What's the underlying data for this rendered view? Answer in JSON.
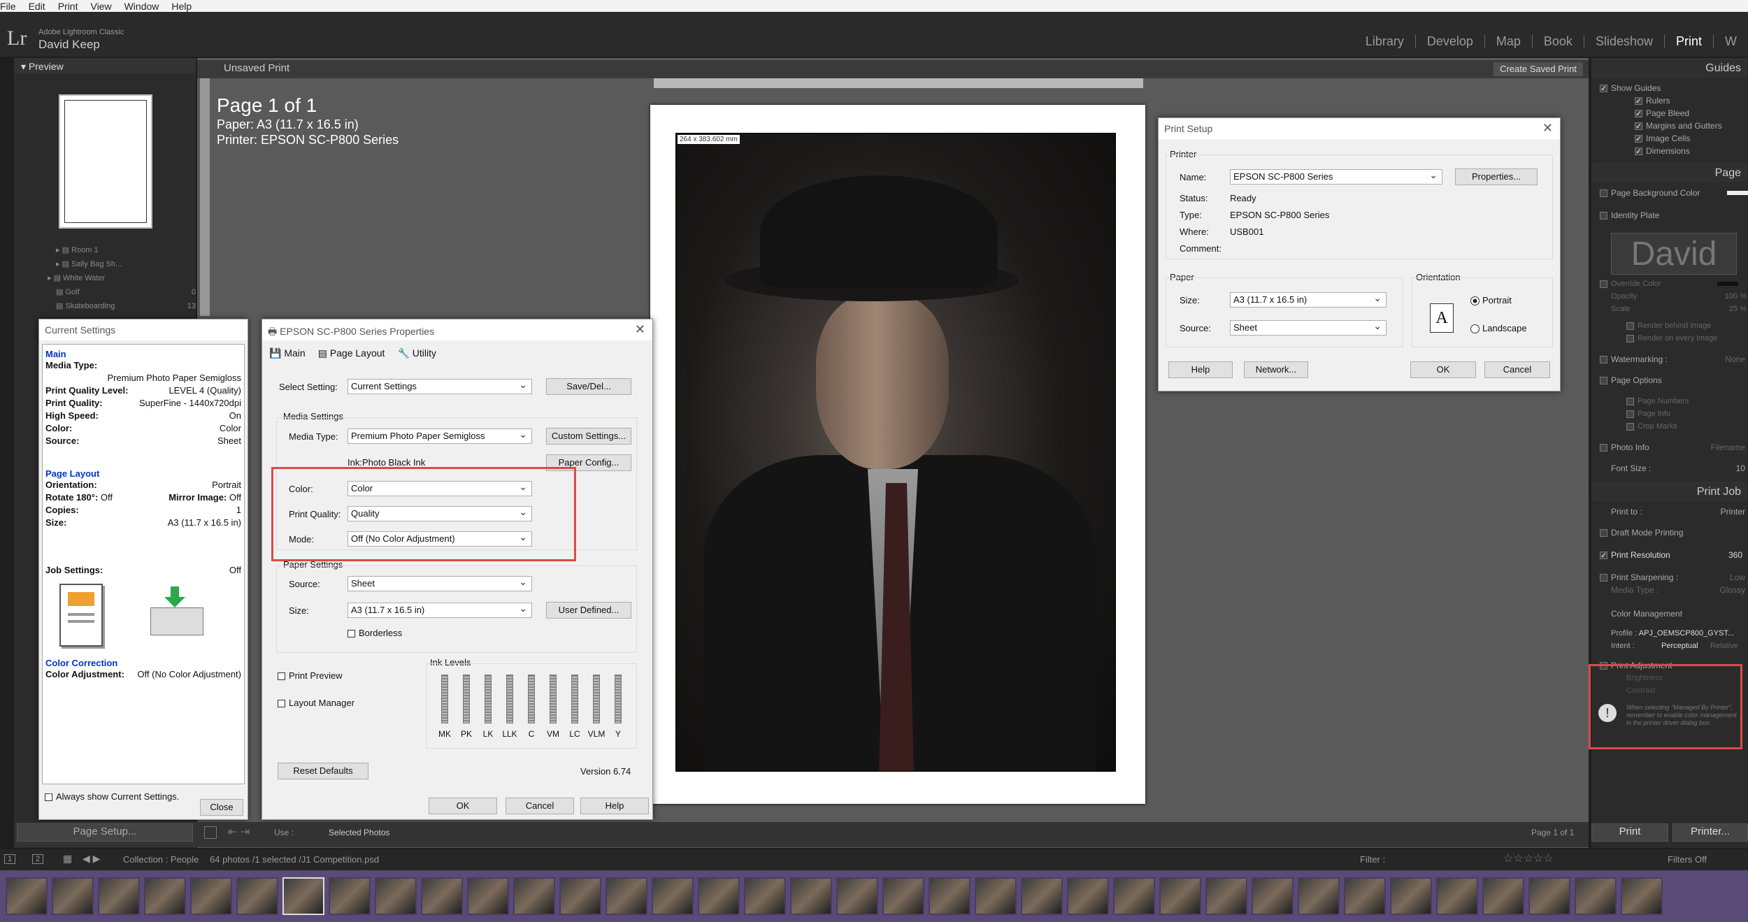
{
  "menu": [
    "File",
    "Edit",
    "Print",
    "View",
    "Window",
    "Help"
  ],
  "app": {
    "logo": "Lr",
    "name": "Adobe Lightroom Classic",
    "user": "David Keep"
  },
  "modules": [
    "Library",
    "Develop",
    "Map",
    "Book",
    "Slideshow",
    "Print",
    "W"
  ],
  "active_module": "Print",
  "left_panel": {
    "preview_label": "Preview",
    "collections": [
      {
        "name": "Room 1",
        "count": ""
      },
      {
        "name": "Sally Bag Sh...",
        "count": ""
      },
      {
        "name": "White Water",
        "count": ""
      },
      {
        "name": "Golf",
        "count": "0"
      },
      {
        "name": "Skateboarding",
        "count": "13"
      }
    ],
    "page_setup_btn": "Page Setup..."
  },
  "print_title": "Unsaved Print",
  "create_saved_print": "Create Saved Print",
  "page_info": {
    "page": "Page 1 of 1",
    "paper": "Paper:  A3 (11.7 x 16.5 in)",
    "printer": "Printer:  EPSON SC-P800 Series"
  },
  "photo_dims": "264 x 383.602 mm",
  "current_settings": {
    "title": "Current Settings",
    "main_label": "Main",
    "rows1": [
      {
        "k": "Media Type:",
        "v": ""
      },
      {
        "k": "",
        "v": "Premium Photo Paper Semigloss"
      },
      {
        "k": "Print Quality Level:",
        "v": "LEVEL 4 (Quality)"
      },
      {
        "k": "Print Quality:",
        "v": "SuperFine - 1440x720dpi"
      },
      {
        "k": "High Speed:",
        "v": "On"
      },
      {
        "k": "Color:",
        "v": "Color"
      },
      {
        "k": "Source:",
        "v": "Sheet"
      }
    ],
    "layout_label": "Page Layout",
    "rows2": [
      {
        "k": "Orientation:",
        "v": "Portrait"
      },
      {
        "k": "Rotate 180°:",
        "v": "Off"
      },
      {
        "k": "Mirror Image:",
        "v": "Off"
      },
      {
        "k": "Copies:",
        "v": "1"
      },
      {
        "k": "Size:",
        "v": "A3 (11.7 x 16.5 in)"
      }
    ],
    "job_settings": "Job Settings:",
    "job_value": "Off",
    "cc_label": "Color Correction",
    "cc_key": "Color Adjustment:",
    "cc_val": "Off (No Color Adjustment)",
    "always_show": "Always show Current Settings.",
    "close": "Close"
  },
  "epson": {
    "title": "EPSON SC-P800 Series Properties",
    "tabs": [
      "Main",
      "Page Layout",
      "Utility"
    ],
    "select_setting_label": "Select Setting:",
    "select_setting": "Current Settings",
    "save_del": "Save/Del...",
    "media_settings": "Media Settings",
    "media_type_label": "Media Type:",
    "media_type": "Premium Photo Paper Semigloss",
    "custom_settings": "Custom Settings...",
    "ink_label": "Ink:Photo Black Ink",
    "paper_config": "Paper Config...",
    "color_label": "Color:",
    "color": "Color",
    "pq_label": "Print Quality:",
    "pq": "Quality",
    "mode_label": "Mode:",
    "mode": "Off (No Color Adjustment)",
    "paper_settings": "Paper Settings",
    "source_label": "Source:",
    "source": "Sheet",
    "size_label": "Size:",
    "size": "A3 (11.7 x 16.5 in)",
    "user_defined": "User Defined...",
    "borderless": "Borderless",
    "print_preview": "Print Preview",
    "layout_manager": "Layout Manager",
    "ink_levels": "Ink Levels",
    "inks": [
      "MK",
      "PK",
      "LK",
      "LLK",
      "C",
      "VM",
      "LC",
      "VLM",
      "Y"
    ],
    "reset": "Reset Defaults",
    "version": "Version 6.74",
    "ok": "OK",
    "cancel": "Cancel",
    "help": "Help"
  },
  "print_setup": {
    "title": "Print Setup",
    "printer_group": "Printer",
    "name_label": "Name:",
    "name": "EPSON SC-P800 Series",
    "properties": "Properties...",
    "status_label": "Status:",
    "status": "Ready",
    "type_label": "Type:",
    "type": "EPSON SC-P800 Series",
    "where_label": "Where:",
    "where": "USB001",
    "comment_label": "Comment:",
    "paper_group": "Paper",
    "size_label": "Size:",
    "size": "A3 (11.7 x 16.5 in)",
    "source_label": "Source:",
    "source": "Sheet",
    "orientation_group": "Orientation",
    "portrait": "Portrait",
    "landscape": "Landscape",
    "help": "Help",
    "network": "Network...",
    "ok": "OK",
    "cancel": "Cancel"
  },
  "right_panel": {
    "guides": "Guides",
    "show_guides": "Show Guides",
    "guide_items": [
      "Rulers",
      "Page Bleed",
      "Margins and Gutters",
      "Image Cells",
      "Dimensions"
    ],
    "page": "Page",
    "page_bg": "Page Background Color",
    "identity_plate": "Identity Plate",
    "plate_text": "David",
    "override": "Override Color",
    "opacity": "Opacity",
    "opacity_val": "100 %",
    "scale": "Scale",
    "scale_val": "25 %",
    "render_behind": "Render behind image",
    "render_every": "Render on every image",
    "watermarking": "Watermarking :",
    "watermark_val": "None",
    "page_options": "Page Options",
    "page_opts": [
      "Page Numbers",
      "Page Info",
      "Crop Marks"
    ],
    "photo_info": "Photo Info",
    "photo_info_val": "Filename",
    "font_size": "Font Size :",
    "font_size_val": "10",
    "print_job": "Print Job",
    "print_to": "Print to :",
    "print_to_val": "Printer",
    "draft": "Draft Mode Printing",
    "resolution": "Print Resolution",
    "resolution_val": "360",
    "sharpening": "Print Sharpening :",
    "sharpening_val": "Low",
    "media_type": "Media Type :",
    "media_type_val": "Glossy",
    "color_mgmt": "Color Management",
    "profile": "Profile :",
    "profile_val": "APJ_OEMSCP800_GYST...",
    "intent": "Intent :",
    "intent_perc": "Perceptual",
    "intent_rel": "Relative",
    "print_adj": "Print Adjustment",
    "brightness": "Brightness",
    "contrast": "Contrast",
    "warning": "When selecting \"Managed By Printer\", remember to enable color management in the printer driver dialog box.",
    "print_btn": "Print",
    "printer_btn": "Printer..."
  },
  "bottom": {
    "use_label": "Use :",
    "use_val": "Selected Photos",
    "page_count": "Page 1 of 1"
  },
  "filmstrip_bar": {
    "collection": "Collection : People",
    "count": "64 photos /1 selected /J1 Competition.psd",
    "filter": "Filter :",
    "filters_off": "Filters Off"
  }
}
